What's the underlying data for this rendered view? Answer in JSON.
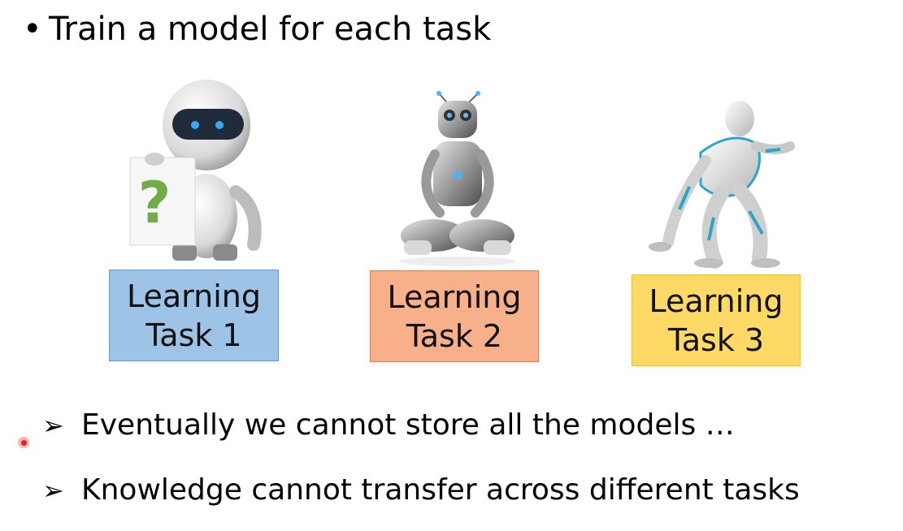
{
  "slide": {
    "bullet_symbol": "•",
    "title": "Train a model for each task",
    "tasks": [
      {
        "line1": "Learning",
        "line2": "Task 1",
        "fill": "#9dc3e6",
        "border": "#5b9bd5"
      },
      {
        "line1": "Learning",
        "line2": "Task 2",
        "fill": "#f8b08a",
        "border": "#ed7d31"
      },
      {
        "line1": "Learning",
        "line2": "Task 3",
        "fill": "#ffd966",
        "border": "#ffc000"
      }
    ],
    "robot1_sign": "?",
    "arrow_symbol": "➢",
    "points": [
      "Eventually we cannot store all the models …",
      "Knowledge cannot transfer across different tasks"
    ]
  }
}
